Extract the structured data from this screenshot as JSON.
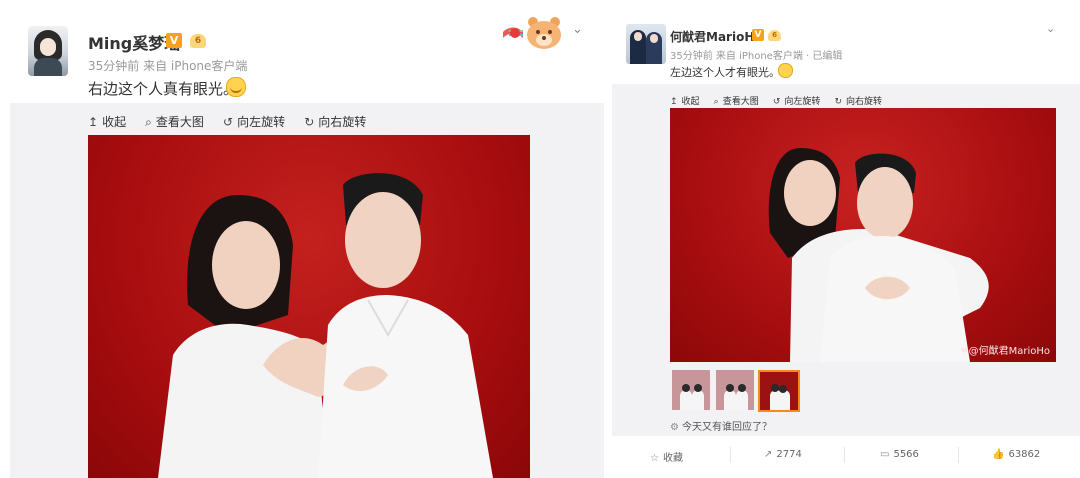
{
  "left_post": {
    "author": "Ming奚梦瑶",
    "v_badge": "V",
    "crown_badge": "6",
    "meta": "35分钟前 来自 iPhone客户端",
    "text": "右边这个人真有眼光。",
    "emoji": "smile-emoji",
    "toolbar": [
      {
        "icon": "↥",
        "label": "收起"
      },
      {
        "icon": "⌕",
        "label": "查看大图"
      },
      {
        "icon": "↺",
        "label": "向左旋转"
      },
      {
        "icon": "↻",
        "label": "向右旋转"
      }
    ],
    "chevron": "⌄"
  },
  "right_post": {
    "author": "何猷君MarioHo",
    "v_badge": "V",
    "crown_badge": "6",
    "meta": "35分钟前 来自 iPhone客户端 · 已编辑",
    "text": "左边这个人才有眼光。",
    "emoji": "grin-emoji",
    "toolbar": [
      {
        "icon": "↥",
        "label": "收起"
      },
      {
        "icon": "⌕",
        "label": "查看大图"
      },
      {
        "icon": "↺",
        "label": "向左旋转"
      },
      {
        "icon": "↻",
        "label": "向右旋转"
      }
    ],
    "watermark": "❤@何猷君MarioHo",
    "reply_prompt": "今天又有谁回应了？",
    "actions": {
      "favorite": "收藏",
      "repost": "2774",
      "comment": "5566",
      "like": "63862"
    },
    "chevron": "⌄"
  },
  "colors": {
    "photo_red": "#a80d0f",
    "badge_orange": "#f7a21b",
    "panel_bg": "#f2f2f5",
    "selected_thumb_border": "#f28a1e"
  }
}
